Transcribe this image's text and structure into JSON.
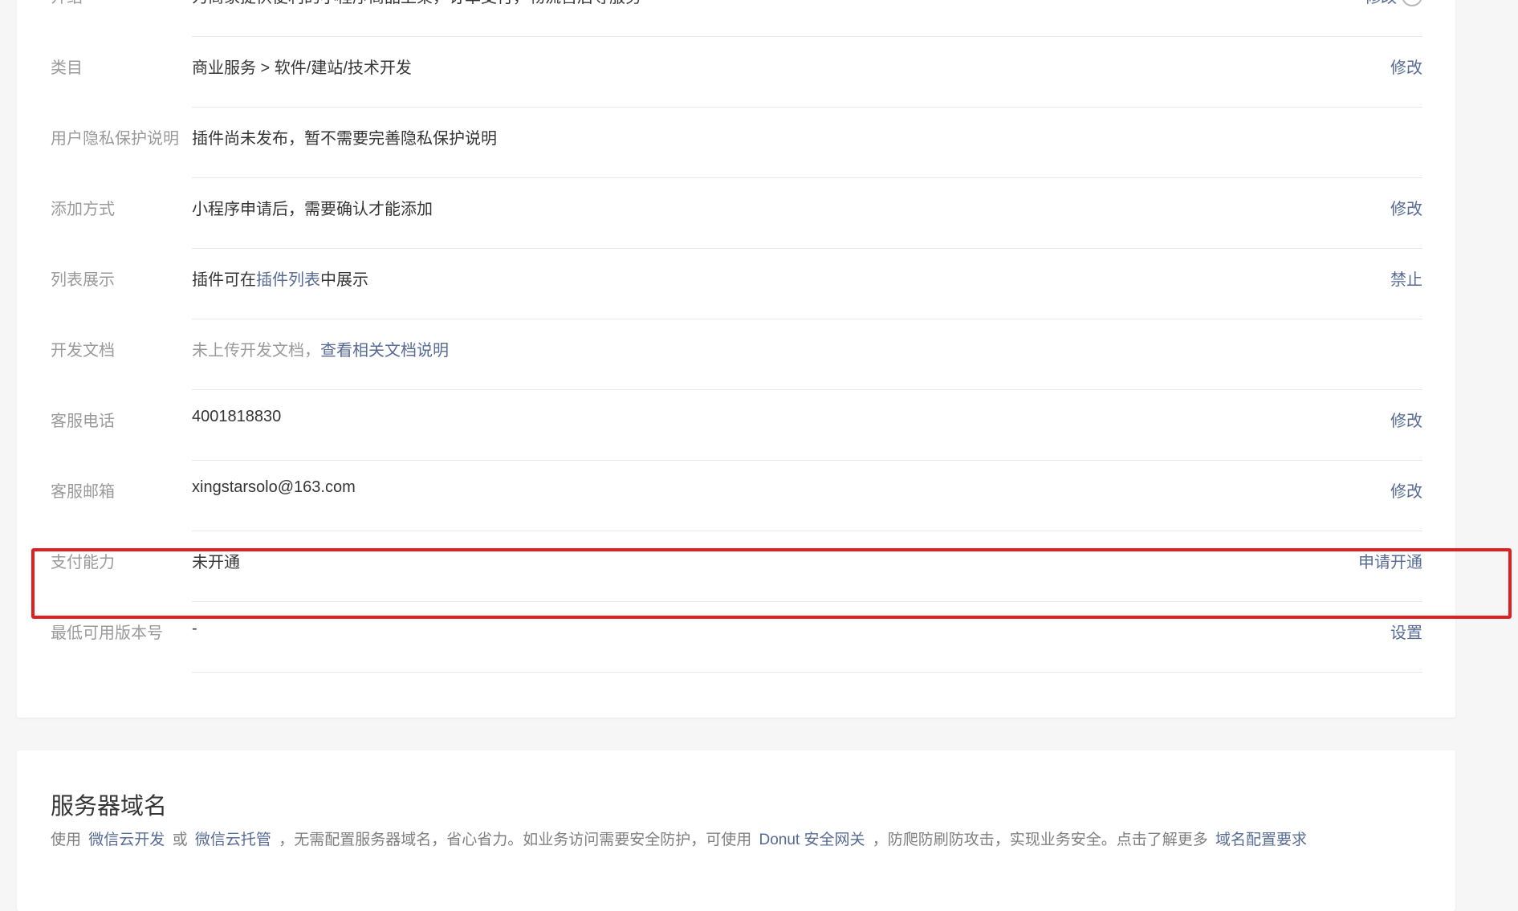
{
  "rows": [
    {
      "label": "介绍",
      "value": "为商家提供便利的小程序商品上架，订单支付，物流售后等服务",
      "action": "修改"
    },
    {
      "label": "类目",
      "value": "商业服务 > 软件/建站/技术开发",
      "action": "修改"
    },
    {
      "label": "用户隐私保护说明",
      "value": "插件尚未发布，暂不需要完善隐私保护说明"
    },
    {
      "label": "添加方式",
      "value": "小程序申请后，需要确认才能添加",
      "action": "修改"
    },
    {
      "label": "列表展示",
      "value_prefix": "插件可在",
      "value_link": "插件列表",
      "value_suffix": "中展示",
      "action": "禁止"
    },
    {
      "label": "开发文档",
      "value_prefix": "未上传开发文档，",
      "value_link": "查看相关文档说明"
    },
    {
      "label": "客服电话",
      "value": "4001818830",
      "action": "修改"
    },
    {
      "label": "客服邮箱",
      "value": "xingstarsolo@163.com",
      "action": "修改"
    },
    {
      "label": "支付能力",
      "value": "未开通",
      "action": "申请开通"
    },
    {
      "label": "最低可用版本号",
      "value": "-",
      "action": "设置"
    }
  ],
  "help_icon": "question-circle-icon",
  "server_domain": {
    "title": "服务器域名",
    "desc_1": "使用",
    "link_1": "微信云开发",
    "desc_2": "或",
    "link_2": "微信云托管",
    "desc_3": "，无需配置服务器域名，省心省力。如业务访问需要安全防护，可使用",
    "link_3": "Donut 安全网关",
    "desc_4": "，防爬防刷防攻击，实现业务安全。点击了解更多",
    "link_4": "域名配置要求"
  },
  "colors": {
    "link": "#576b95",
    "highlight": "#e02020",
    "label": "#9a9a9a",
    "text": "#353535"
  }
}
